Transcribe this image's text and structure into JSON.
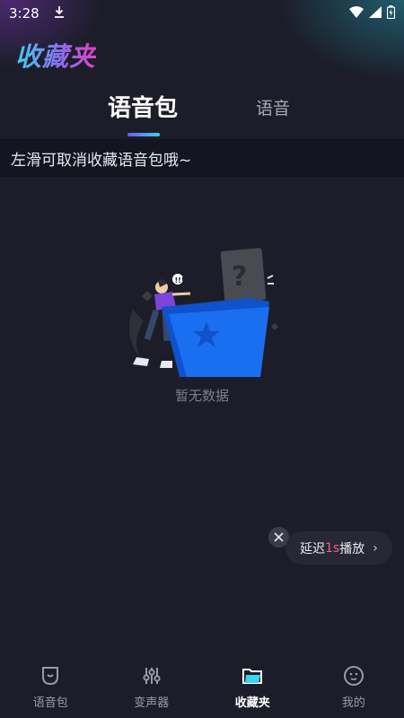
{
  "status_bar": {
    "time": "3:28"
  },
  "header": {
    "title": "收藏夹"
  },
  "tabs": [
    {
      "label": "语音包",
      "active": true
    },
    {
      "label": "语音",
      "active": false
    }
  ],
  "hint": {
    "text": "左滑可取消收藏语音包哦~"
  },
  "empty_state": {
    "text": "暂无数据"
  },
  "delay_control": {
    "prefix": "延迟",
    "highlight": "1s",
    "suffix": "播放"
  },
  "bottom_nav": {
    "items": [
      {
        "label": "语音包",
        "icon": "voice-pack-icon"
      },
      {
        "label": "变声器",
        "icon": "mixer-sliders-icon"
      },
      {
        "label": "收藏夹",
        "icon": "folder-icon",
        "active": true
      },
      {
        "label": "我的",
        "icon": "profile-face-icon"
      }
    ]
  },
  "colors": {
    "background": "#1c1d29",
    "accent_blue": "#1a6ff0",
    "highlight_pink": "#ff5a7a"
  }
}
